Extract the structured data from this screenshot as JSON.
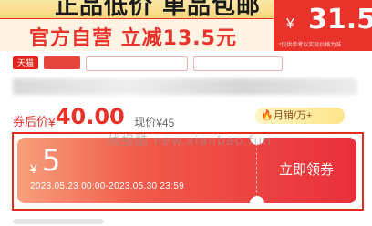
{
  "banner": {
    "title": "正品低价 单品包邮",
    "subtitle": "官方自营 立减13.5元",
    "currency": "¥",
    "price": "31.5",
    "note": "*仅供参考以实际价格为准"
  },
  "tags": [
    "天猫"
  ],
  "price": {
    "after_label": "券后价",
    "after_currency": "¥",
    "after_value": "40.00",
    "now_label": "现价",
    "now_currency": "¥",
    "now_value": "45"
  },
  "sales": {
    "label": "月销/万+"
  },
  "watermark": "线报酷 new.xianbao.fun",
  "coupon": {
    "currency": "¥",
    "amount": "5",
    "validity": "2023.05.23 00:00-2023.05.30 23:59",
    "button_label": "立即领券"
  },
  "colors": {
    "brand_red": "#e8322a",
    "coupon_gradient_start": "#f6a07c",
    "coupon_gradient_end": "#e92f3a"
  }
}
